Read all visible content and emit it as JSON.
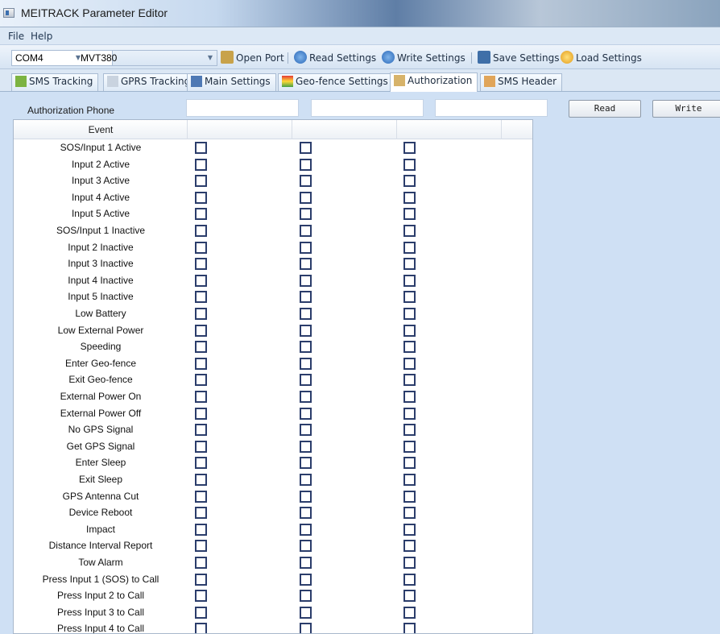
{
  "window": {
    "title": "MEITRACK Parameter Editor"
  },
  "menu": {
    "items": [
      "File",
      "Help"
    ]
  },
  "toolbar": {
    "port_value": "COM4",
    "device_value": "MVT380",
    "open_port_label": "Open Port",
    "read_settings_label": "Read Settings",
    "write_settings_label": "Write Settings",
    "save_settings_label": "Save Settings",
    "load_settings_label": "Load Settings"
  },
  "tabs": [
    {
      "label": "SMS Tracking"
    },
    {
      "label": "GPRS Tracking"
    },
    {
      "label": "Main Settings"
    },
    {
      "label": "Geo-fence Settings"
    },
    {
      "label": "Authorization",
      "active": true
    },
    {
      "label": "SMS Header"
    }
  ],
  "authorization": {
    "label": "Authorization Phone",
    "phones": [
      "",
      "",
      ""
    ],
    "read_label": "Read",
    "write_label": "Write"
  },
  "grid": {
    "event_header": "Event",
    "events": [
      "SOS/Input 1 Active",
      "Input 2 Active",
      "Input 3 Active",
      "Input 4 Active",
      "Input 5 Active",
      "SOS/Input 1 Inactive",
      "Input 2 Inactive",
      "Input 3 Inactive",
      "Input 4 Inactive",
      "Input 5 Inactive",
      "Low Battery",
      "Low External Power",
      "Speeding",
      "Enter Geo-fence",
      "Exit Geo-fence",
      "External Power On",
      "External Power Off",
      "No GPS Signal",
      "Get GPS Signal",
      "Enter Sleep",
      "Exit Sleep",
      "GPS Antenna Cut",
      "Device Reboot",
      "Impact",
      "Distance Interval Report",
      "Tow Alarm",
      "Press Input 1 (SOS) to Call",
      "Press Input 2 to Call",
      "Press Input 3 to Call",
      "Press Input 4 to Call"
    ],
    "checked": false
  },
  "colors": {
    "background": "#cfe0f4",
    "checkbox_border": "#2b3d6b"
  }
}
